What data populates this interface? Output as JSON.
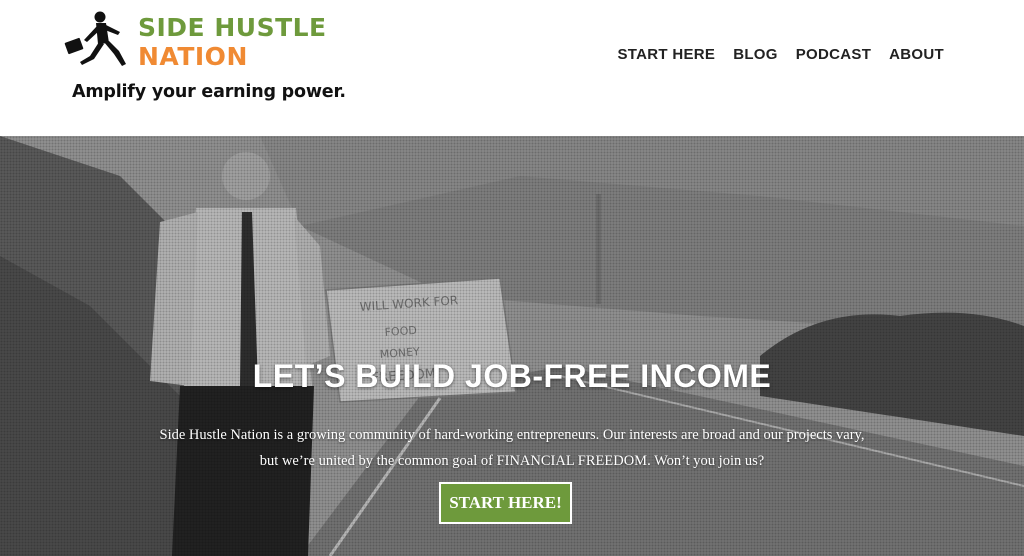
{
  "brand": {
    "line1": "SIDE HUSTLE",
    "line2": "NATION",
    "tagline": "Amplify your earning power.",
    "colors": {
      "green": "#6e9a3c",
      "orange": "#f08a33"
    }
  },
  "nav": {
    "items": [
      {
        "label": "START HERE"
      },
      {
        "label": "BLOG"
      },
      {
        "label": "PODCAST"
      },
      {
        "label": "ABOUT"
      }
    ]
  },
  "hero": {
    "heading": "LET’S BUILD JOB-FREE INCOME",
    "text": "Side Hustle Nation is a growing community of hard-working entrepreneurs. Our interests are broad and our projects vary, but we’re united by the common goal of FINANCIAL FREEDOM. Won’t you join us?",
    "button_label": "START HERE!",
    "sign_text": "WILL WORK FOR FOOD MONEY FREEDOM"
  }
}
